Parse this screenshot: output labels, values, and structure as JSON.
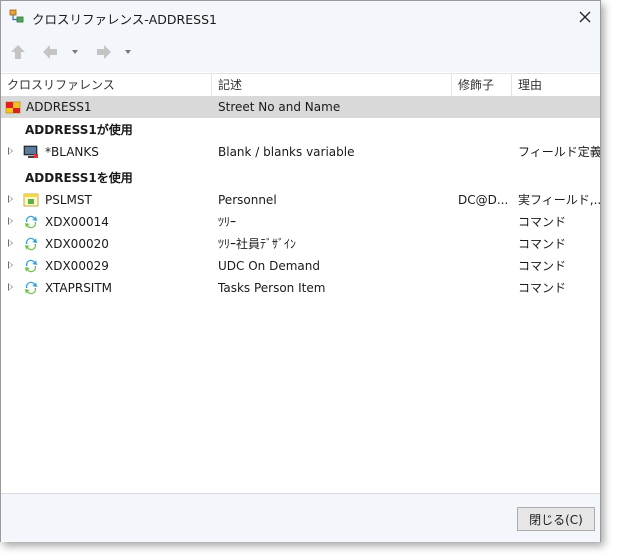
{
  "window": {
    "title": "クロスリファレンス-ADDRESS1"
  },
  "columns": {
    "xref": "クロスリファレンス",
    "desc": "記述",
    "modifier": "修飾子",
    "reason": "理由"
  },
  "root": {
    "name": "ADDRESS1",
    "desc": "Street No and Name",
    "modifier": "",
    "reason": ""
  },
  "groups": [
    {
      "label": "ADDRESS1が使用",
      "items": [
        {
          "name": "*BLANKS",
          "desc": "Blank / blanks variable",
          "modifier": "",
          "reason": "フィールド定義",
          "icon": "monitor-icon"
        }
      ]
    },
    {
      "label": "ADDRESS1を使用",
      "items": [
        {
          "name": "PSLMST",
          "desc": "Personnel",
          "modifier": "DC@D...",
          "reason": "実フィールド,...",
          "icon": "table-icon"
        },
        {
          "name": "XDX00014",
          "desc": "ﾂﾘｰ",
          "modifier": "",
          "reason": "コマンド",
          "icon": "command-icon"
        },
        {
          "name": "XDX00020",
          "desc": "ﾂﾘｰ社員ﾃﾞｻﾞｲﾝ",
          "modifier": "",
          "reason": "コマンド",
          "icon": "command-icon"
        },
        {
          "name": "XDX00029",
          "desc": "UDC On Demand",
          "modifier": "",
          "reason": "コマンド",
          "icon": "command-icon"
        },
        {
          "name": "XTAPRSITM",
          "desc": "Tasks Person Item",
          "modifier": "",
          "reason": "コマンド",
          "icon": "command-icon"
        }
      ]
    }
  ],
  "footer": {
    "close_label": "閉じる(C)"
  },
  "icons": {
    "back": "back-arrow-icon",
    "forward": "forward-arrow-icon",
    "up": "up-arrow-icon"
  },
  "colors": {
    "selected_row": "#d9d9d9",
    "chrome": "#f3f6fa"
  }
}
